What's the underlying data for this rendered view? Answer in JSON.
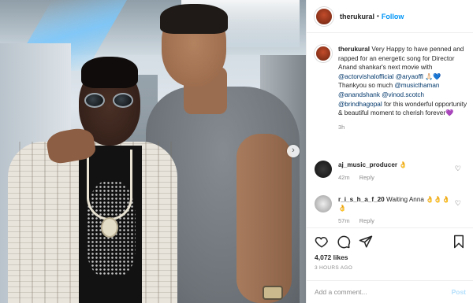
{
  "header": {
    "username": "therukural",
    "separator": "•",
    "follow_label": "Follow"
  },
  "caption": {
    "username": "therukural",
    "text_1": "Very Happy to have penned and rapped for an energetic song for Director Anand shankar's next movie with",
    "mention_1": "@actorvishalofficial",
    "mention_2": "@aryaoffl",
    "emoji_1": "🙏🏻💙",
    "text_2": "Thankyou so much",
    "mention_3": "@musicthaman",
    "mention_4": "@anandshank",
    "mention_5": "@vinod.scotch",
    "mention_6": "@brindhagopal",
    "text_3": "for this wonderful opportunity & beautiful moment to cherish forever",
    "emoji_2": "💜",
    "time": "3h"
  },
  "comments": [
    {
      "username": "aj_music_producer",
      "text": "👌",
      "time": "42m",
      "reply_label": "Reply"
    },
    {
      "username": "r_i_s_h_a_f_20",
      "text": "Waiting Anna 👌👌👌👌",
      "time": "57m",
      "reply_label": "Reply"
    }
  ],
  "actions": {
    "likes": "4,072 likes",
    "time_ago": "3 HOURS AGO"
  },
  "add_comment": {
    "placeholder": "Add a comment...",
    "post_label": "Post"
  },
  "photo": {
    "next_icon": "chevron-right-icon"
  },
  "colors": {
    "link_blue": "#0095f6",
    "mention": "#00376b",
    "muted": "#8e8e8e",
    "post_disabled": "#b2dffc"
  }
}
